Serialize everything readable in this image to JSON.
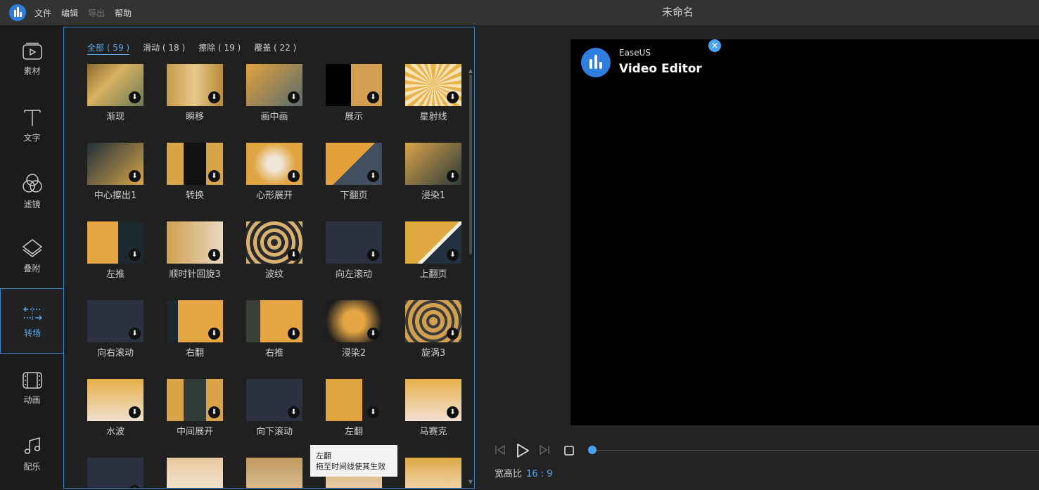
{
  "app": {
    "menu": [
      "文件",
      "编辑",
      "导出",
      "帮助"
    ],
    "title": "未命名"
  },
  "sidebar": {
    "items": [
      {
        "label": "素材",
        "icon": "media-icon"
      },
      {
        "label": "文字",
        "icon": "text-icon"
      },
      {
        "label": "滤镜",
        "icon": "filter-icon"
      },
      {
        "label": "叠附",
        "icon": "overlay-icon"
      },
      {
        "label": "转场",
        "icon": "transition-icon",
        "active": true
      },
      {
        "label": "动画",
        "icon": "film-icon"
      },
      {
        "label": "配乐",
        "icon": "music-icon"
      }
    ]
  },
  "panel": {
    "tabs": [
      {
        "label": "全部 ( 59 )",
        "active": true
      },
      {
        "label": "滑动 ( 18 )"
      },
      {
        "label": "擦除 ( 19 )"
      },
      {
        "label": "覆盖 ( 22 )"
      }
    ],
    "transitions": [
      "渐现",
      "瞬移",
      "画中画",
      "展示",
      "星射线",
      "中心擦出1",
      "转换",
      "心形展开",
      "下翻页",
      "浸染1",
      "左推",
      "顺时针回旋3",
      "波纹",
      "向左滚动",
      "上翻页",
      "向右滚动",
      "右翻",
      "右推",
      "浸染2",
      "旋涡3",
      "水波",
      "中间展开",
      "向下滚动",
      "左翻",
      "马赛克",
      "",
      "",
      "",
      "",
      ""
    ],
    "tooltip": {
      "title": "左翻",
      "hint": "拖至时间线使其生效"
    }
  },
  "preview": {
    "watermark_line1": "EaseUS",
    "watermark_line2": "Video Editor",
    "aspect_label": "宽高比",
    "aspect_value": "16 : 9"
  }
}
